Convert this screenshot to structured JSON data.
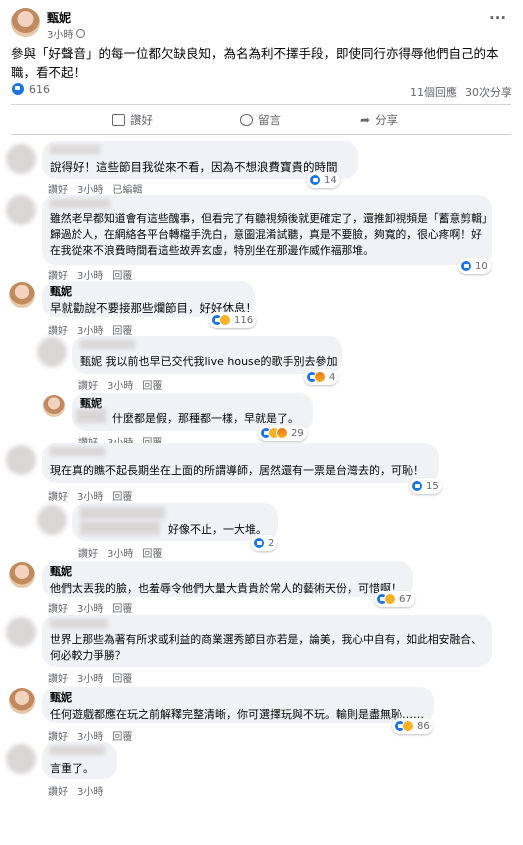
{
  "post": {
    "author": "甄妮",
    "time": "3小時",
    "more": "···",
    "text": "參與「好聲音」的每一位都欠缺良知，為名為利不擇手段，即使同行亦得辱他們自己的本職，看不起！",
    "likes": "616",
    "comments_count": "11個回應",
    "shares_count": "30次分享"
  },
  "actions": {
    "like": "讚好",
    "comment": "留言",
    "share": "分享"
  },
  "meta_labels": {
    "like": "讚好",
    "reply": "回覆",
    "edited": "已編輯"
  },
  "comments": [
    {
      "author": "",
      "text": "說得好！這些節目我從來不看，因為不想浪費寶貴的時間",
      "time": "3小時",
      "edited": "已編輯",
      "reactions": "14"
    },
    {
      "author": "",
      "text": "雖然老早都知道會有這些醜事，但看完了有聽視頻後就更確定了，還推卸視頻是「蓄意剪輯」歸過於人，在網絡各平台轉檔手洗白，意圖混淆試聽，真是不要臉，夠寬的，很心疼啊！好在我從來不浪費時間看這些故弄玄虛，特別坐在那邊作威作福那堆。",
      "time": "3小時",
      "reactions": "10"
    },
    {
      "author": "甄妮",
      "text": "早就勸說不要接那些爛節目，好好休息！",
      "time": "3小時",
      "reactions": "116"
    },
    {
      "author": "",
      "text": "甄妮 我以前也早已交代我live house的歌手別去參加",
      "time": "3小時",
      "reactions": "4"
    },
    {
      "author": "甄妮",
      "text": "什麼都是假，那種都一樣，早就是了。",
      "time": "3小時",
      "reactions": "29"
    },
    {
      "author": "",
      "text": "現在真的瞧不起長期坐在上面的所謂導師，居然還有一票是台灣去的，可恥！",
      "time": "3小時",
      "reactions": "15"
    },
    {
      "author": "",
      "text": "好像不止，一大堆。",
      "time": "3小時",
      "reactions": "2"
    },
    {
      "author": "甄妮",
      "text": "他們太丟我的臉，也羞辱令他們大量大貴貴於常人的藝術天份，可惜啊！",
      "time": "3小時",
      "reactions": "67"
    },
    {
      "author": "",
      "text": "世界上那些為著有所求或利益的商業選秀節目亦若是，論美，我心中自有，如此相安融合、何必較力爭勝？",
      "time": "3小時"
    },
    {
      "author": "甄妮",
      "text": "任何遊戲都應在玩之前解釋完整清晰，你可選擇玩與不玩。輸則是盡無恥……",
      "time": "3小時",
      "reactions": "86"
    },
    {
      "author": "",
      "text": "言重了。",
      "time": "3小時"
    }
  ],
  "colors": {
    "accent": "#1b74e4",
    "bubble": "#f0f2f5",
    "meta": "#65676b"
  }
}
